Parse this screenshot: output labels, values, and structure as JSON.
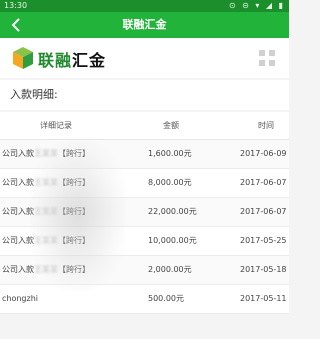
{
  "status_bar": {
    "time": "13:30",
    "icons": "⊙ ⊝ ▾ ◢ ▮"
  },
  "header": {
    "title": "联融汇金"
  },
  "logo": {
    "brand_text": "联融",
    "brand_tail": "汇金"
  },
  "section": {
    "title": "入款明细:"
  },
  "table": {
    "columns": [
      "详细记录",
      "金额",
      "时间"
    ],
    "rows": [
      {
        "detail_prefix": "公司入款",
        "detail_blur": "王某某",
        "detail_suffix": "【跨行】",
        "amount": "1,600.00元",
        "time": "2017-06-09"
      },
      {
        "detail_prefix": "公司入款",
        "detail_blur": "王某某",
        "detail_suffix": "【跨行】",
        "amount": "8,000.00元",
        "time": "2017-06-07"
      },
      {
        "detail_prefix": "公司入款",
        "detail_blur": "王某某",
        "detail_suffix": "【跨行】",
        "amount": "22,000.00元",
        "time": "2017-06-07"
      },
      {
        "detail_prefix": "公司入款",
        "detail_blur": "王某某",
        "detail_suffix": "【跨行】",
        "amount": "10,000.00元",
        "time": "2017-05-25"
      },
      {
        "detail_prefix": "公司入款",
        "detail_blur": "王某某",
        "detail_suffix": "【跨行】",
        "amount": "2,000.00元",
        "time": "2017-05-18"
      },
      {
        "detail_prefix": "chongzhi",
        "detail_blur": "",
        "detail_suffix": "",
        "amount": "500.00元",
        "time": "2017-05-11"
      }
    ]
  },
  "colors": {
    "primary_green": "#22b33a",
    "status_green": "#1a8f2c"
  }
}
